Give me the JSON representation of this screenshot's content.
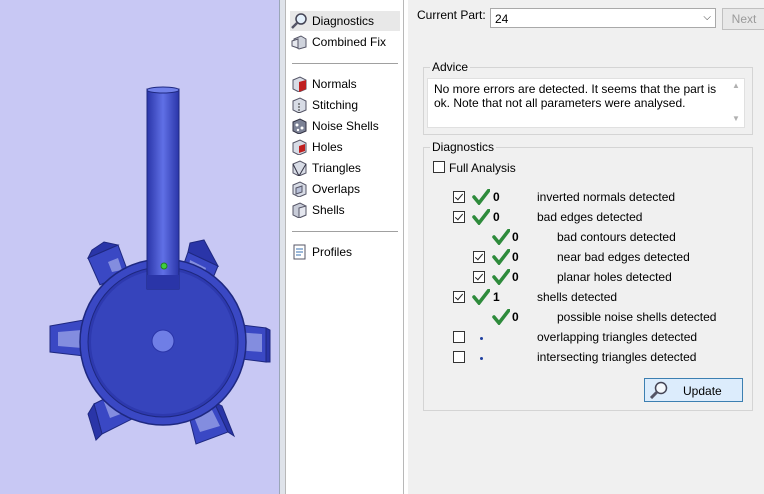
{
  "viewport": {
    "background": "#c8c8f4",
    "model_color": "#4a5cd6",
    "model_dark": "#2a35a8"
  },
  "tools": [
    {
      "label": "Diagnostics",
      "icon": "magnifier-icon",
      "selected": true
    },
    {
      "label": "Combined Fix",
      "icon": "combined-fix-icon"
    },
    {
      "label": "Normals",
      "icon": "normals-icon"
    },
    {
      "label": "Stitching",
      "icon": "stitching-icon"
    },
    {
      "label": "Noise Shells",
      "icon": "noise-shells-icon"
    },
    {
      "label": "Holes",
      "icon": "holes-icon"
    },
    {
      "label": "Triangles",
      "icon": "triangles-icon"
    },
    {
      "label": "Overlaps",
      "icon": "overlaps-icon"
    },
    {
      "label": "Shells",
      "icon": "shells-icon"
    },
    {
      "label": "Profiles",
      "icon": "profiles-icon"
    }
  ],
  "header": {
    "current_part_label": "Current Part:",
    "current_part_value": "24",
    "next_label": "Next"
  },
  "advice": {
    "title": "Advice",
    "text": "No more errors are detected. It seems that the part is ok. Note that not all parameters were analysed."
  },
  "diagnostics": {
    "title": "Diagnostics",
    "full_analysis_label": "Full Analysis",
    "full_analysis_checked": false,
    "rows": [
      {
        "checked": true,
        "status": "ok",
        "count": "0",
        "label": "inverted normals detected"
      },
      {
        "checked": true,
        "status": "ok",
        "count": "0",
        "label": "bad edges detected"
      },
      {
        "checked": null,
        "status": "ok",
        "count": "0",
        "label": "bad contours detected"
      },
      {
        "checked": true,
        "status": "ok",
        "count": "0",
        "label": "near bad edges detected"
      },
      {
        "checked": true,
        "status": "ok",
        "count": "0",
        "label": "planar holes detected"
      },
      {
        "checked": true,
        "status": "ok",
        "count": "1",
        "label": "shells detected"
      },
      {
        "checked": null,
        "status": "ok",
        "count": "0",
        "label": "possible noise shells detected"
      },
      {
        "checked": false,
        "status": "none",
        "count": "",
        "label": "overlapping triangles detected"
      },
      {
        "checked": false,
        "status": "none",
        "count": "",
        "label": "intersecting triangles detected"
      }
    ],
    "update_label": "Update"
  }
}
